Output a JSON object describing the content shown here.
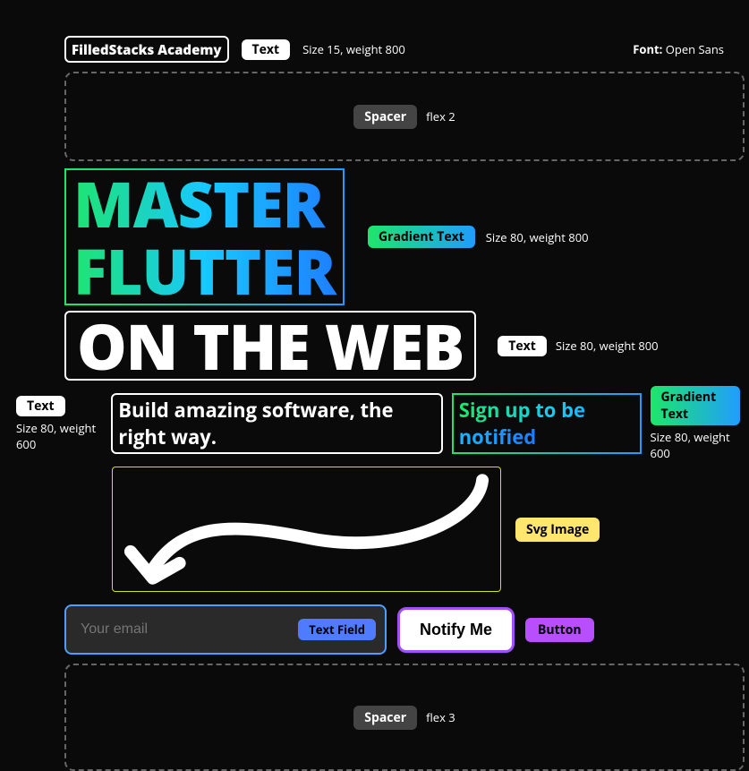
{
  "header": {
    "brand": "FilledStacks Academy",
    "text_label": "Text",
    "text_meta": "Size 15, weight 800",
    "font_label": "Font:",
    "font_value": "Open Sans"
  },
  "spacer1": {
    "label": "Spacer",
    "meta": "flex 2"
  },
  "hero": {
    "line1": "MASTER",
    "line2": "FLUTTER",
    "grad_label": "Gradient Text",
    "grad_meta": "Size 80, weight 800",
    "line3": "ON THE WEB",
    "text_label": "Text",
    "text_meta": "Size 80, weight 800"
  },
  "sub": {
    "text_label": "Text",
    "text_meta_left": "Size 80, weight 600",
    "body": "Build amazing software, the right way.",
    "signup": "Sign up to be notified",
    "grad_label": "Gradient Text",
    "grad_meta_right": "Size 80, weight 600"
  },
  "svg": {
    "label": "Svg Image"
  },
  "form": {
    "placeholder": "Your email",
    "field_label": "Text Field",
    "button": "Notify Me",
    "button_label": "Button"
  },
  "spacer2": {
    "label": "Spacer",
    "meta": "flex 3"
  }
}
